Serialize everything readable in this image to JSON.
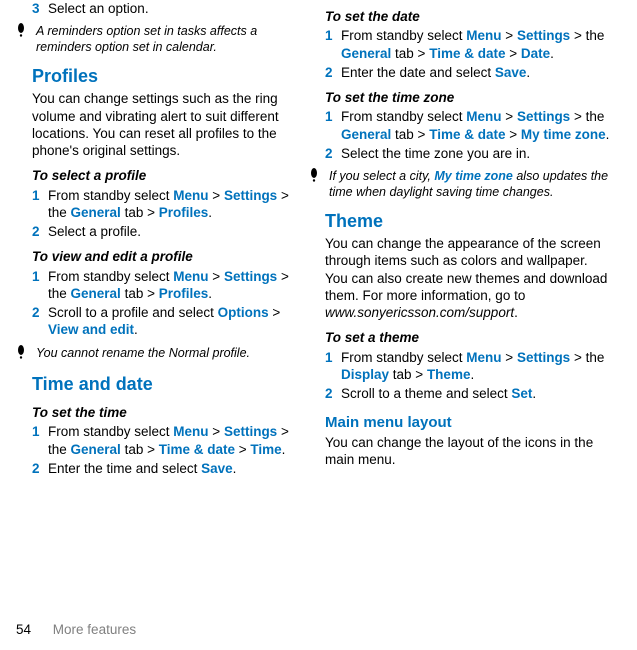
{
  "col1": {
    "step3_num": "3",
    "step3_text": "Select an option.",
    "note1": "A reminders option set in tasks affects a reminders option set in calendar.",
    "profiles_h": "Profiles",
    "profiles_p": "You can change settings such as the ring volume and vibrating alert to suit different locations. You can reset all profiles to the phone's original settings.",
    "select_profile_h": "To select a profile",
    "sp_step1_num": "1",
    "sp_step1_a": "From standby select ",
    "sp_menu": "Menu",
    "sp_gt": " > ",
    "sp_settings": "Settings",
    "sp_gt2": " > the ",
    "sp_general": "General",
    "sp_tab": " tab > ",
    "sp_profiles": "Profiles",
    "sp_dot": ".",
    "sp_step2_num": "2",
    "sp_step2_text": "Select a profile.",
    "view_edit_h": "To view and edit a profile",
    "ve_step1_num": "1",
    "ve_step2_num": "2",
    "ve_step2_a": "Scroll to a profile and select ",
    "ve_options": "Options",
    "ve_viewedit": "View and edit",
    "note2": "You cannot rename the Normal profile.",
    "timedate_h": "Time and date",
    "set_time_h": "To set the time",
    "st_step1_num": "1",
    "st_timedate": "Time & date",
    "st_time": "Time",
    "st_step2_num": "2",
    "st_step2_a": "Enter the time and select ",
    "st_save": "Save"
  },
  "col2": {
    "set_date_h": "To set the date",
    "sd_step1_num": "1",
    "sd_date": "Date",
    "sd_step2_num": "2",
    "sd_step2_a": "Enter the date and select ",
    "set_tz_h": "To set the time zone",
    "tz_step1_num": "1",
    "tz_mytz": "My time zone",
    "tz_step2_num": "2",
    "tz_step2_text": "Select the time zone you are in.",
    "note3_a": "If you select a city, ",
    "note3_mtz": "My time zone",
    "note3_b": " also updates the time when daylight saving time changes.",
    "theme_h": "Theme",
    "theme_p_a": "You can change the appearance of the screen through items such as colors and wallpaper. You can also create new themes and download them. For more information, go to ",
    "theme_url": "www.sonyericsson.com/support",
    "set_theme_h": "To set a theme",
    "sth_step1_num": "1",
    "sth_display": "Display",
    "sth_theme": "Theme",
    "sth_step2_num": "2",
    "sth_step2_a": "Scroll to a theme and select ",
    "sth_set": "Set",
    "mml_h": "Main menu layout",
    "mml_p": "You can change the layout of the icons in the main menu."
  },
  "footer": {
    "page": "54",
    "section": "More features"
  }
}
